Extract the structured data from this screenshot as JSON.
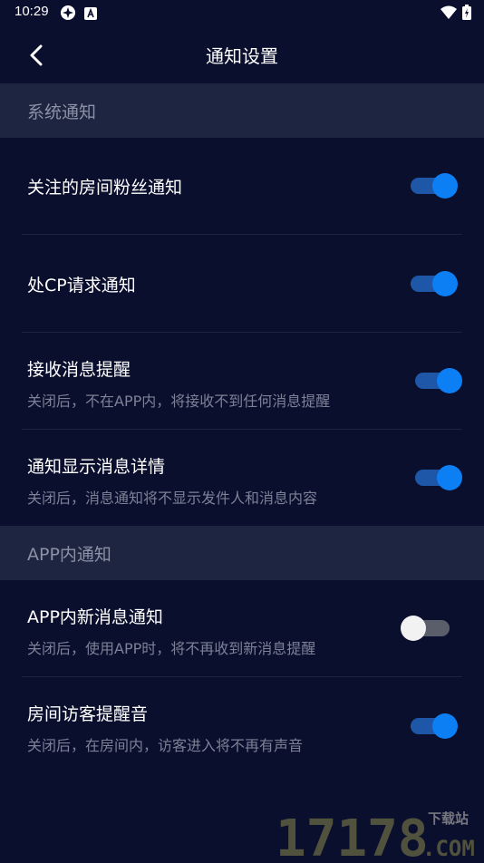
{
  "status_bar": {
    "time": "10:29"
  },
  "header": {
    "title": "通知设置"
  },
  "sections": [
    {
      "title": "系统通知",
      "items": [
        {
          "title": "关注的房间粉丝通知",
          "desc": "",
          "enabled": true
        },
        {
          "title": "处CP请求通知",
          "desc": "",
          "enabled": true
        },
        {
          "title": "接收消息提醒",
          "desc": "关闭后，不在APP内，将接收不到任何消息提醒",
          "enabled": true
        },
        {
          "title": "通知显示消息详情",
          "desc": "关闭后，消息通知将不显示发件人和消息内容",
          "enabled": true
        }
      ]
    },
    {
      "title": "APP内通知",
      "items": [
        {
          "title": "APP内新消息通知",
          "desc": "关闭后，使用APP时，将不再收到新消息提醒",
          "enabled": false
        },
        {
          "title": "房间访客提醒音",
          "desc": "关闭后，在房间内，访客进入将不再有声音",
          "enabled": true
        }
      ]
    }
  ],
  "watermark": {
    "digits": "17178",
    "top_text": "下载站",
    "domain": ".COM"
  },
  "colors": {
    "background": "#0b0f2e",
    "section": "#1e2541",
    "accent": "#0d7ff5",
    "track_on": "#1e57a8"
  }
}
